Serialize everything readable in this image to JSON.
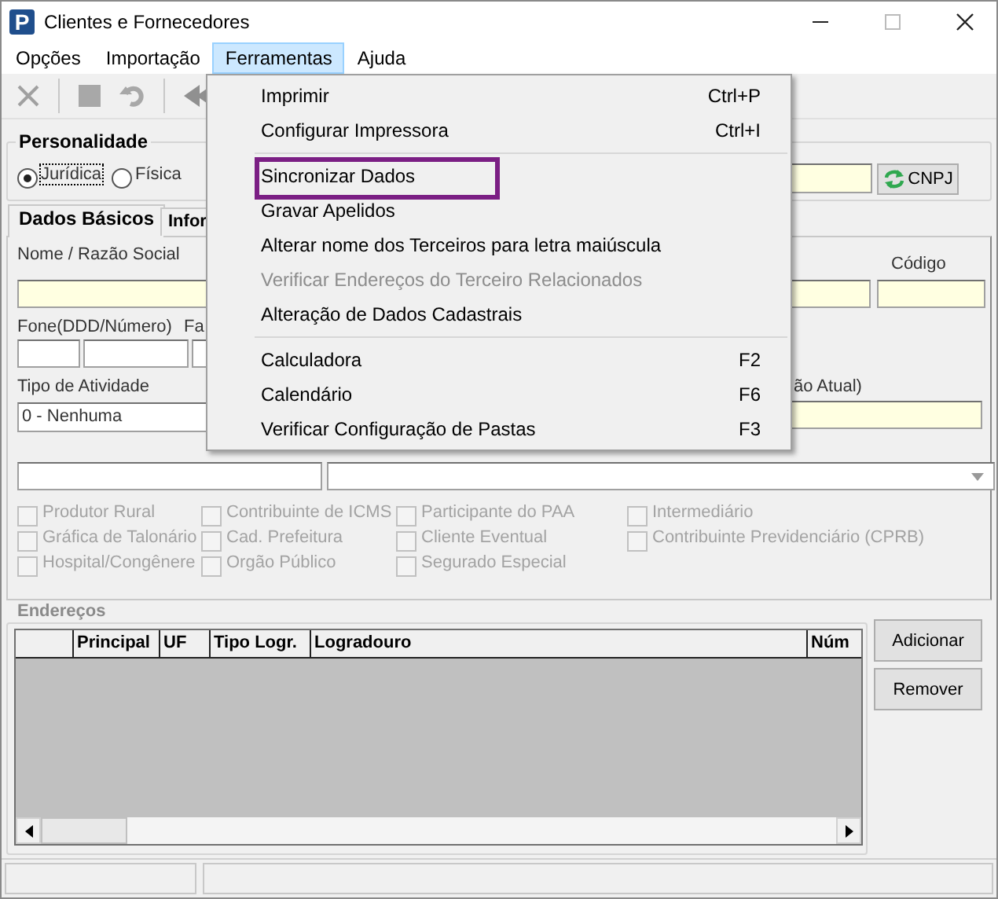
{
  "window": {
    "title": "Clientes e Fornecedores",
    "icon_letter": "P"
  },
  "menu_bar": [
    {
      "label": "Opções",
      "selected": false
    },
    {
      "label": "Importação",
      "selected": false
    },
    {
      "label": "Ferramentas",
      "selected": true
    },
    {
      "label": "Ajuda",
      "selected": false
    }
  ],
  "personalidade": {
    "title": "Personalidade",
    "options": [
      {
        "label": "Jurídica",
        "selected": true
      },
      {
        "label": "Física",
        "selected": false
      }
    ]
  },
  "cnpj_button": "CNPJ",
  "tabs": [
    {
      "label": "Dados Básicos",
      "selected": true
    },
    {
      "label": "Infor",
      "selected": false
    }
  ],
  "form": {
    "name_label": "Nome / Razão Social",
    "code_label": "Código",
    "phone_label": "Fone(DDD/Número)",
    "label_4": "Fa",
    "activity_label": "Tipo de Atividade",
    "activity_value": "0 - Nenhuma",
    "label_6": "ão Atual)"
  },
  "checkboxes": [
    {
      "label": "Produtor Rural",
      "checked": false,
      "disabled": true
    },
    {
      "label": "Contribuinte de ICMS",
      "checked": false,
      "disabled": true
    },
    {
      "label": "Participante do PAA",
      "checked": false,
      "disabled": true
    },
    {
      "label": "Intermediário",
      "checked": false,
      "disabled": true
    },
    {
      "label": "Gráfica de Talonário",
      "checked": false,
      "disabled": true
    },
    {
      "label": "Cad. Prefeitura",
      "checked": false,
      "disabled": true
    },
    {
      "label": "Cliente Eventual",
      "checked": false,
      "disabled": true
    },
    {
      "label": "Contribuinte Previdenciário (CPRB)",
      "checked": false,
      "disabled": true
    },
    {
      "label": "Hospital/Congênere",
      "checked": false,
      "disabled": true
    },
    {
      "label": "Orgão Público",
      "checked": false,
      "disabled": true
    },
    {
      "label": "Segurado Especial",
      "checked": false,
      "disabled": true
    }
  ],
  "addresses": {
    "title": "Endereços",
    "columns": [
      "Principal",
      "UF",
      "Tipo Logr.",
      "Logradouro",
      "Núm"
    ]
  },
  "buttons": [
    "Adicionar",
    "Remover"
  ],
  "menu": {
    "items": [
      {
        "kind": "item",
        "label": "Imprimir",
        "shortcut": "Ctrl+P",
        "disabled": false,
        "highlighted": false
      },
      {
        "kind": "item",
        "label": "Configurar Impressora",
        "shortcut": "Ctrl+I",
        "disabled": false,
        "highlighted": false
      },
      {
        "kind": "separator"
      },
      {
        "kind": "item",
        "label": "Sincronizar Dados",
        "disabled": false,
        "highlighted": true
      },
      {
        "kind": "item",
        "label": "Gravar Apelidos",
        "disabled": false,
        "highlighted": false
      },
      {
        "kind": "item",
        "label": "Alterar nome dos Terceiros para letra maiúscula",
        "disabled": false,
        "highlighted": false
      },
      {
        "kind": "item",
        "label": "Verificar Endereços do Terceiro Relacionados",
        "disabled": true,
        "highlighted": false
      },
      {
        "kind": "item",
        "label": "Alteração de Dados Cadastrais",
        "disabled": false,
        "highlighted": false
      },
      {
        "kind": "separator"
      },
      {
        "kind": "item",
        "label": "Calculadora",
        "shortcut": "F2",
        "disabled": false,
        "highlighted": false
      },
      {
        "kind": "item",
        "label": "Calendário",
        "shortcut": "F6",
        "disabled": false,
        "highlighted": false
      },
      {
        "kind": "item",
        "label": "Verificar Configuração de Pastas",
        "shortcut": "F3",
        "disabled": false,
        "highlighted": false
      }
    ]
  }
}
